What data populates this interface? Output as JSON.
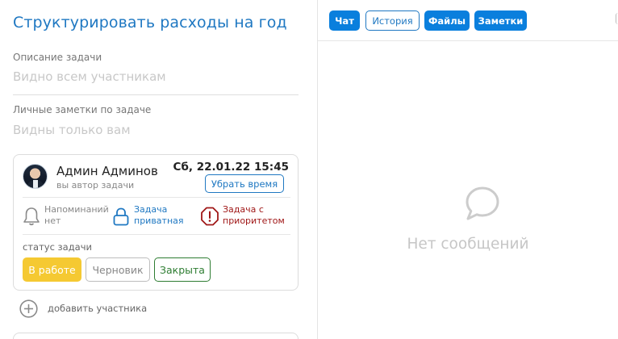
{
  "task": {
    "title": "Структурировать расходы на год",
    "description_label": "Описание задачи",
    "description_placeholder": "Видно всем участникам",
    "notes_label": "Личные заметки по задаче",
    "notes_placeholder": "Видны только вам"
  },
  "card": {
    "user_name": "Админ Админов",
    "user_role": "вы автор задачи",
    "datetime": "Сб, 22.01.22 15:45",
    "remove_time_label": "Убрать время",
    "reminder_line1": "Напоминаний",
    "reminder_line2": "нет",
    "private_line1": "Задача",
    "private_line2": "приватная",
    "priority_line1": "Задача с",
    "priority_line2": "приоритетом",
    "status_label": "статус задачи",
    "statuses": [
      "В работе",
      "Черновик",
      "Закрыта"
    ],
    "add_member_label": "добавить участника"
  },
  "tabs": [
    "Чат",
    "История",
    "Файлы",
    "Заметки"
  ],
  "chat": {
    "empty_text": "Нет сообщений"
  },
  "colors": {
    "accent": "#1f78c2",
    "tab_fill": "#0a7fdd",
    "status_work": "#f5c932",
    "status_closed": "#2e7d32",
    "priority": "#a01818"
  }
}
